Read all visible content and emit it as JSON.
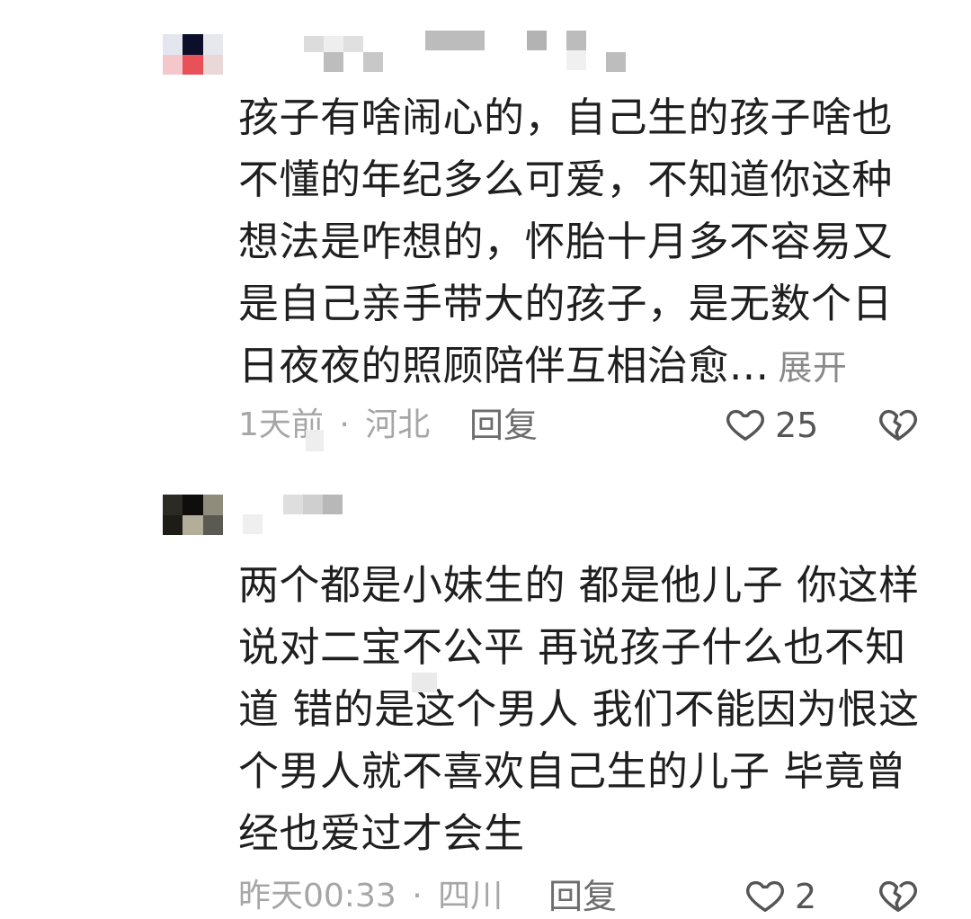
{
  "comments": [
    {
      "text": "孩子有啥闹心的，自己生的孩子啥也不懂的年纪多么可爱，不知道你这种想法是咋想的，怀胎十月多不容易又是自己亲手带大的孩子，是无数个日日夜夜的照顾陪伴互相治愈...",
      "expand_label": "展开",
      "time": "1天前",
      "location": "河北",
      "reply_label": "回复",
      "like_count": "25",
      "avatar_colors": [
        "#e3e6ef",
        "#0d0f2a",
        "#e7e8ee",
        "#f3c7cb",
        "#e8515a",
        "#ead7d8"
      ]
    },
    {
      "text": "两个都是小妹生的 都是他儿子 你这样说对二宝不公平 再说孩子什么也不知道 错的是这个男人 我们不能因为恨这个男人就不喜欢自己生的儿子 毕竟曾经也爱过才会生",
      "time": "昨天00:33",
      "location": "四川",
      "reply_label": "回复",
      "like_count": "2",
      "avatar_colors": [
        "#2b2a24",
        "#0f0e0c",
        "#8f8c7c",
        "#1e1c16",
        "#b3ae9a",
        "#5a5a52"
      ]
    }
  ],
  "separator": "·"
}
